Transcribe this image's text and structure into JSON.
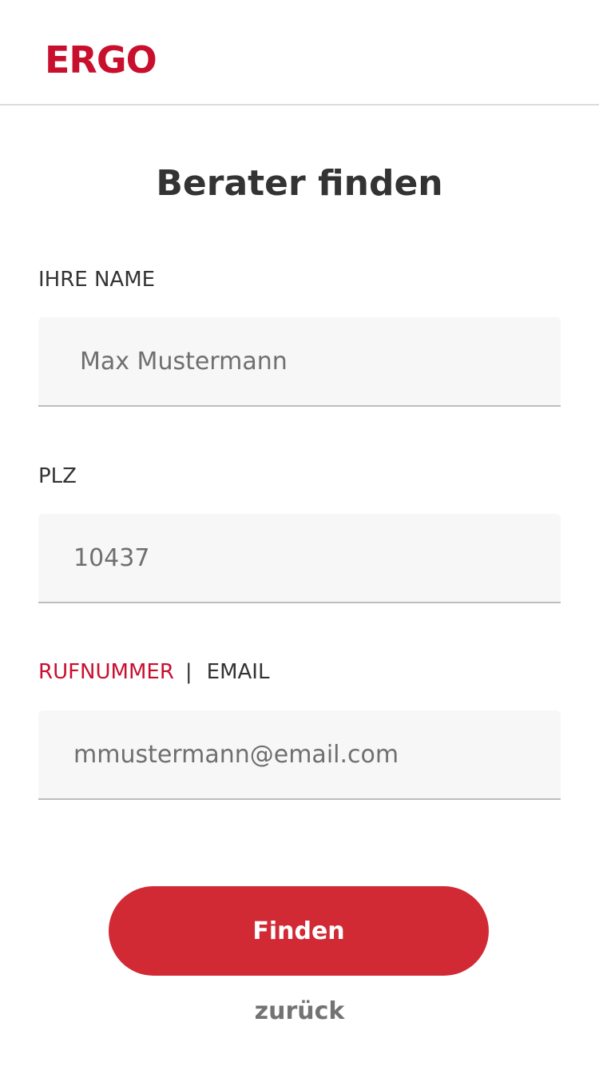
{
  "header": {
    "logo_text": "ERGO",
    "brand_color": "#c8102e"
  },
  "page": {
    "title": "Berater finden"
  },
  "form": {
    "name": {
      "label": "IHRE NAME",
      "placeholder": "Max Mustermann"
    },
    "plz": {
      "label": "PLZ",
      "placeholder": "10437"
    },
    "contact": {
      "options": [
        "RUFNUMMER",
        "EMAIL"
      ],
      "separator": "|",
      "selected": "RUFNUMMER",
      "placeholder": "mmustermann@email.com"
    }
  },
  "actions": {
    "submit_label": "Finden",
    "submit_color": "#d12a35",
    "back_label": "zurück"
  }
}
